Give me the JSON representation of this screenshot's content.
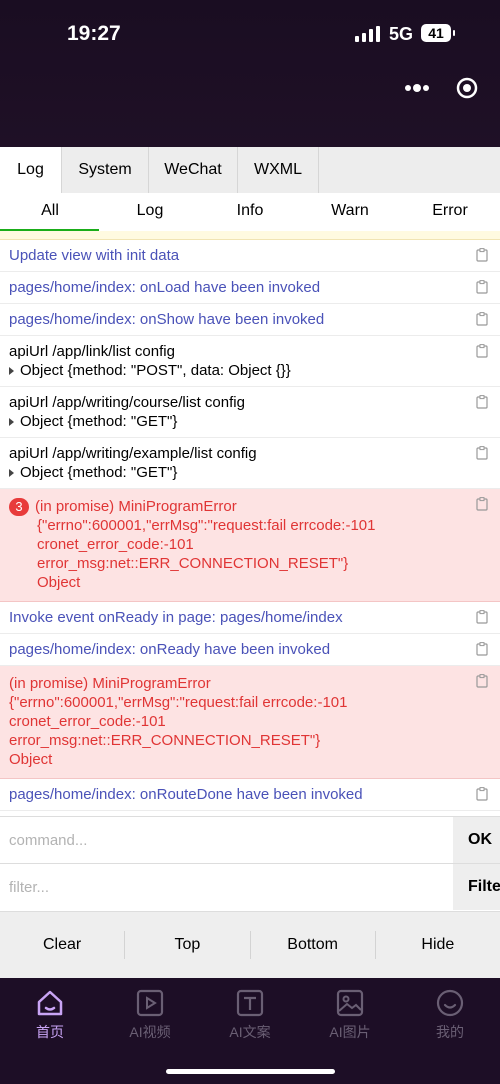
{
  "status": {
    "time": "19:27",
    "network": "5G",
    "battery": "41"
  },
  "tabs_primary": [
    "Log",
    "System",
    "WeChat",
    "WXML"
  ],
  "tabs_filter": [
    "All",
    "Log",
    "Info",
    "Warn",
    "Error"
  ],
  "logs": [
    {
      "text": "Update view with init data"
    },
    {
      "text": "pages/home/index: onLoad have been invoked"
    },
    {
      "text": "pages/home/index: onShow have been invoked"
    },
    {
      "text": "apiUrl /app/link/list config",
      "detail": "Object {method: \"POST\", data: Object {}}"
    },
    {
      "text": "apiUrl /app/writing/course/list config",
      "detail": "Object {method: \"GET\"}"
    },
    {
      "text": "apiUrl /app/writing/example/list config",
      "detail": "Object {method: \"GET\"}"
    },
    {
      "badge": "3",
      "l1": "(in promise) MiniProgramError",
      "l2": "{\"errno\":600001,\"errMsg\":\"request:fail errcode:-101",
      "l3": "cronet_error_code:-101",
      "l4": "error_msg:net::ERR_CONNECTION_RESET\"}",
      "l5": "Object"
    },
    {
      "text": "Invoke event onReady in page: pages/home/index"
    },
    {
      "text": "pages/home/index: onReady have been invoked"
    },
    {
      "l1": "(in promise) MiniProgramError",
      "l2": "{\"errno\":600001,\"errMsg\":\"request:fail errcode:-101",
      "l3": "cronet_error_code:-101",
      "l4": "error_msg:net::ERR_CONNECTION_RESET\"}",
      "l5": "Object"
    },
    {
      "text": "pages/home/index: onRouteDone have been invoked"
    }
  ],
  "command": {
    "placeholder": "command...",
    "button": "OK"
  },
  "filter": {
    "placeholder": "filter...",
    "button": "Filter"
  },
  "actions": [
    "Clear",
    "Top",
    "Bottom",
    "Hide"
  ],
  "nav": [
    {
      "label": "首页",
      "icon": "home-icon"
    },
    {
      "label": "AI视频",
      "icon": "video-icon"
    },
    {
      "label": "AI文案",
      "icon": "text-icon"
    },
    {
      "label": "AI图片",
      "icon": "image-icon"
    },
    {
      "label": "我的",
      "icon": "profile-icon"
    }
  ],
  "colors": {
    "accent": "#c9a4f5",
    "error_bg": "#fde3e3",
    "error_text": "#e03535",
    "info_text": "#4a52b8"
  }
}
